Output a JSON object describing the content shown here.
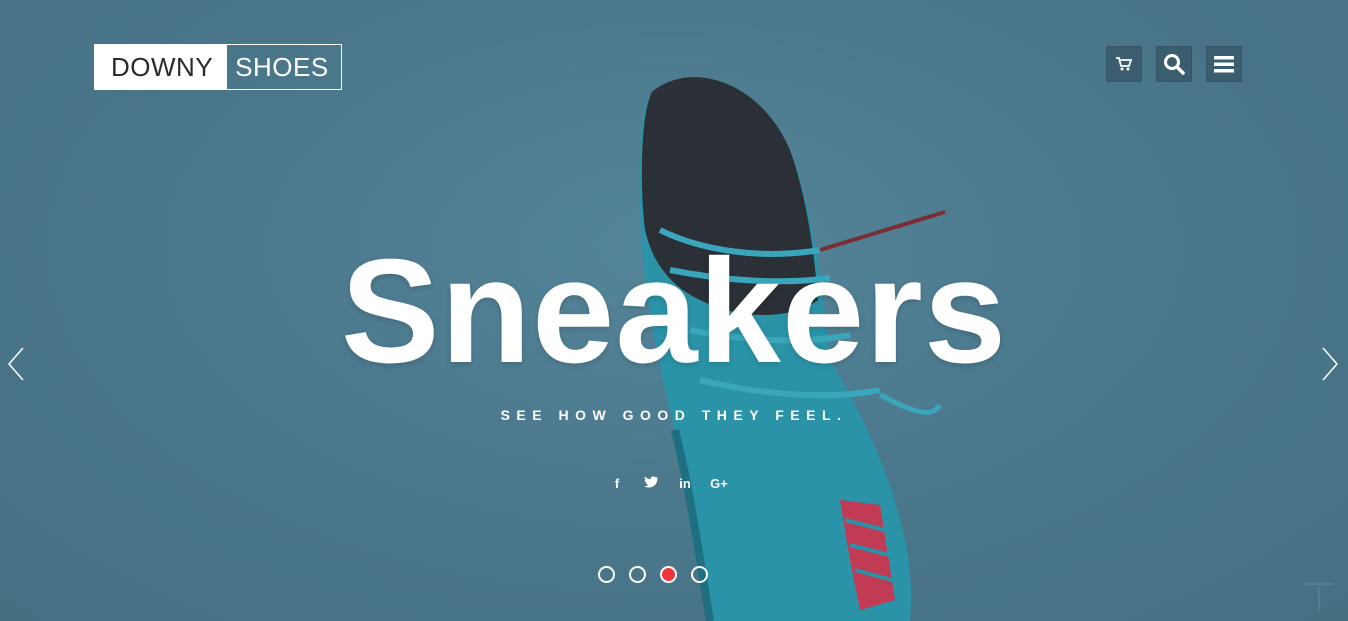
{
  "brand": {
    "part1": "DOWNY",
    "part2": "SHOES"
  },
  "header_icons": [
    "cart-icon",
    "search-icon",
    "menu-icon"
  ],
  "hero": {
    "headline": "Sneakers",
    "tagline": "SEE HOW GOOD THEY FEEL.",
    "social": [
      "f",
      "twitter-icon",
      "in",
      "G+"
    ],
    "active_slide": 3,
    "slide_count": 4
  },
  "colors": {
    "background": "#4a7689",
    "active_dot": "#f0353d",
    "icon_button": "#3b5e6e"
  }
}
